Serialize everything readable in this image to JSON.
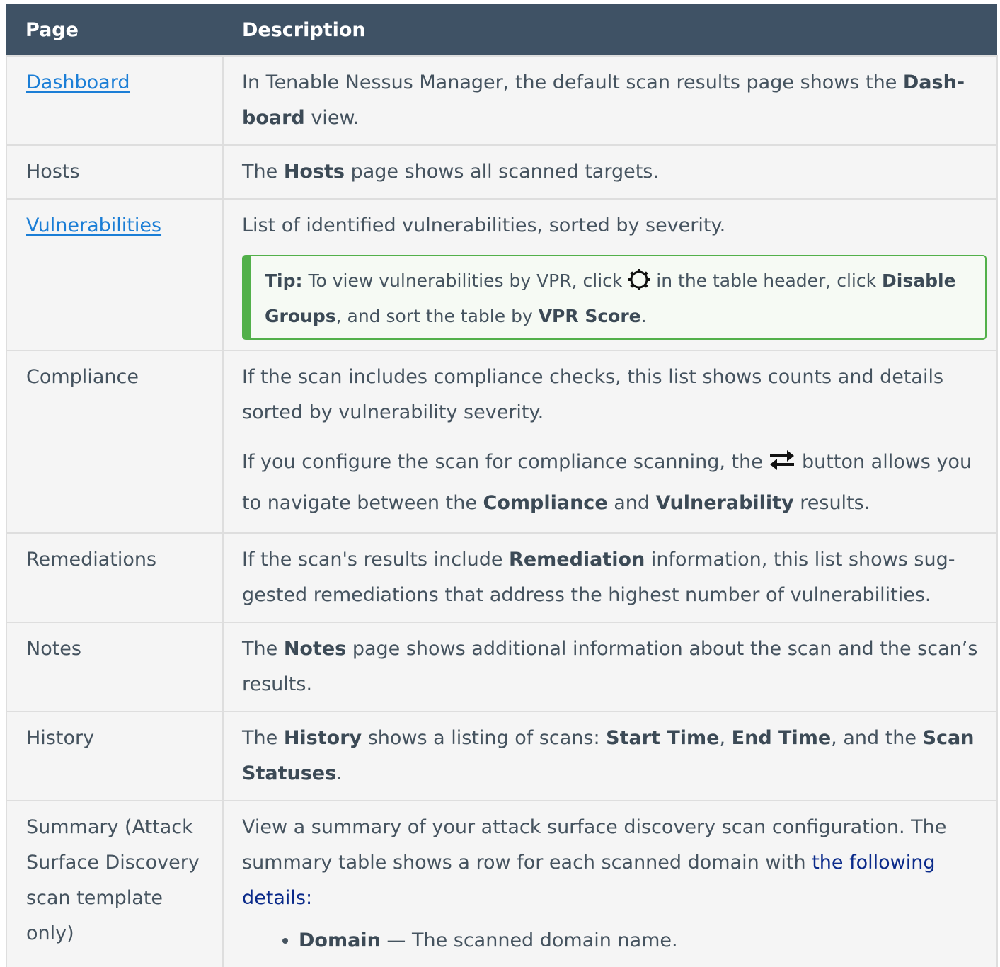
{
  "header": {
    "col_page": "Page",
    "col_description": "Description"
  },
  "rows": {
    "dashboard": {
      "page": "Dashboard",
      "t1": "In Tenable Nessus Manager, the default scan results page shows the ",
      "b1": "Dash­board",
      "t2": " view."
    },
    "hosts": {
      "page": "Hosts",
      "t1": "The ",
      "b1": "Hosts",
      "t2": " page shows all scanned targets."
    },
    "vulnerabilities": {
      "page": "Vulnerabilities",
      "text": "List of identified vulnerabilities, sorted by severity.",
      "tip": {
        "label": "Tip:",
        "t1": " To view vulnerabilities by VPR, click ",
        "icon": "gear-icon",
        "t2": " in the table header, click ",
        "b1": "Disable Groups",
        "t3": ", and sort the table by ",
        "b2": "VPR Score",
        "t4": "."
      }
    },
    "compliance": {
      "page": "Compliance",
      "p1": "If the scan includes compliance checks, this list shows counts and details sorted by vulnerability severity.",
      "p2_t1": "If you configure the scan for compliance scanning, the ",
      "p2_icon": "swap-arrows-icon",
      "p2_t2": " button allows you to navigate between the ",
      "p2_b1": "Compliance",
      "p2_t3": " and ",
      "p2_b2": "Vulnerability",
      "p2_t4": " results."
    },
    "remediations": {
      "page": "Remediations",
      "t1": "If the scan's results include ",
      "b1": "Remediation",
      "t2": " information, this list shows sug­gested remediations that address the highest number of vulnerabilities."
    },
    "notes": {
      "page": "Notes",
      "t1": "The ",
      "b1": "Notes",
      "t2": " page shows additional information about the scan and the scan’s results."
    },
    "history": {
      "page": "History",
      "t1": "The ",
      "b1": "History",
      "t2": " shows a listing of scans: ",
      "b2": "Start Time",
      "t3": ", ",
      "b3": "End Time",
      "t4": ", and the ",
      "b4": "Scan Statuses",
      "t5": "."
    },
    "summary": {
      "page": "Summary (Attack Surface Dis­covery scan tem­plate only)",
      "t1": "View a summary of your attack surface discovery scan configuration. The summary table shows a row for each scanned domain with ",
      "link": "the following details:",
      "bullet_b": "Domain",
      "bullet_t": " — The scanned domain name."
    }
  },
  "colors": {
    "header_bg": "#3f5265",
    "link": "#1b7ed6",
    "tip_border": "#52b04a",
    "cell_bg": "#f5f5f5"
  }
}
